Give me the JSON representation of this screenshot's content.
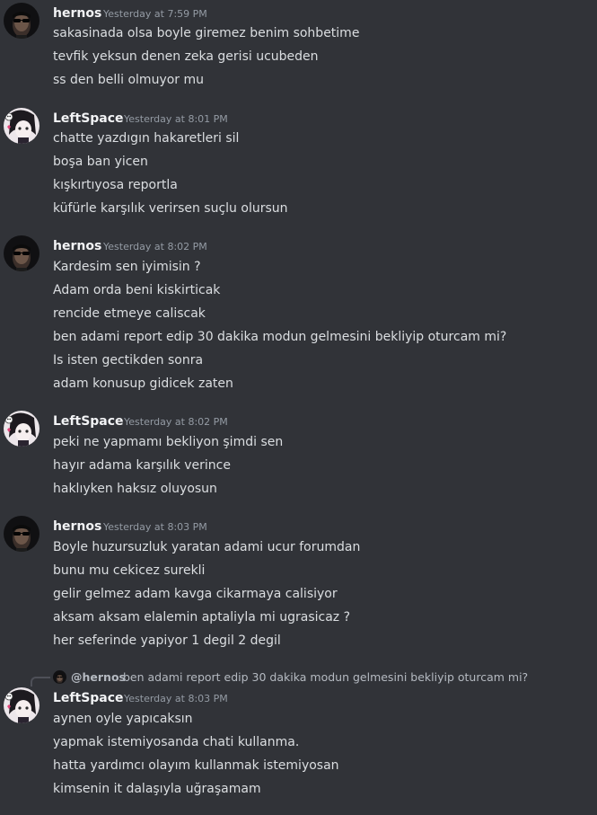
{
  "groups": [
    {
      "author": "hernos",
      "timestamp": "Yesterday at 7:59 PM",
      "avatar_icon": "hernos-avatar-dark-sunglasses",
      "lines": [
        "sakasinada olsa boyle giremez benim sohbetime",
        "tevfik yeksun denen zeka gerisi ucubeden",
        "ss den belli olmuyor mu"
      ]
    },
    {
      "author": "LeftSpace",
      "timestamp": "Yesterday at 8:01 PM",
      "avatar_icon": "leftspace-avatar-anime-skull",
      "lines": [
        "chatte yazdıgın hakaretleri sil",
        "boşa ban yicen",
        "kışkırtıyosa reportla",
        "küfürle karşılık verirsen suçlu olursun"
      ]
    },
    {
      "author": "hernos",
      "timestamp": "Yesterday at 8:02 PM",
      "avatar_icon": "hernos-avatar-dark-sunglasses",
      "lines": [
        "Kardesim sen iyimisin ?",
        "Adam orda beni kiskirticak",
        "rencide etmeye caliscak",
        "ben adami report edip 30 dakika modun gelmesini bekliyip oturcam mi?",
        "Is isten gectikden sonra",
        "adam konusup gidicek zaten"
      ]
    },
    {
      "author": "LeftSpace",
      "timestamp": "Yesterday at 8:02 PM",
      "avatar_icon": "leftspace-avatar-anime-skull",
      "lines": [
        "peki ne yapmamı bekliyon şimdi sen",
        "hayır adama karşılık verince",
        "haklıyken haksız oluyosun"
      ]
    },
    {
      "author": "hernos",
      "timestamp": "Yesterday at 8:03 PM",
      "avatar_icon": "hernos-avatar-dark-sunglasses",
      "lines": [
        "Boyle huzursuzluk yaratan adami ucur forumdan",
        "bunu mu cekicez surekli",
        "gelir gelmez adam kavga cikarmaya calisiyor",
        "aksam aksam elalemin aptaliyla mi ugrasicaz ?",
        "her seferinde yapiyor 1 degil 2 degil"
      ]
    },
    {
      "author": "LeftSpace",
      "timestamp": "Yesterday at 8:03 PM",
      "avatar_icon": "leftspace-avatar-anime-skull",
      "reply": {
        "author": "@hernos",
        "text": "ben adami report edip 30 dakika modun gelmesini bekliyip oturcam mi?"
      },
      "lines": [
        "aynen oyle yapıcaksın",
        "yapmak istemiyosanda chati kullanma.",
        "hatta yardımcı olayım kullanmak istemiyosan",
        "kimsenin it dalaşıyla uğraşamam"
      ]
    }
  ]
}
